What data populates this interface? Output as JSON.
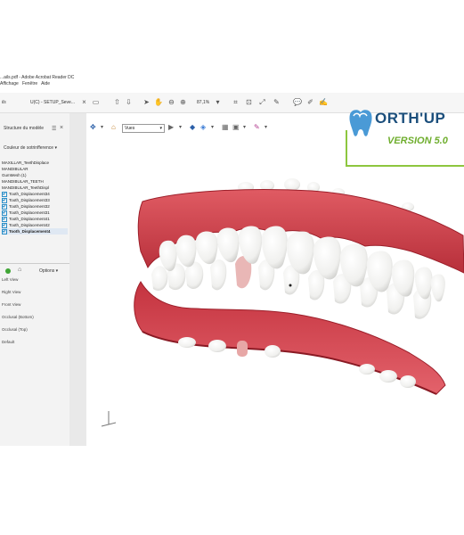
{
  "window": {
    "title": "...ails.pdf - Adobe Acrobat Reader DC",
    "menu": [
      "Affichage",
      "Fenêtre",
      "Aide"
    ]
  },
  "toolbar": {
    "home_label": "ils",
    "file_tab": "U(C) - SETUP_Seve...",
    "zoom": "87,1%"
  },
  "sidebar": {
    "title": "Structure du modèle",
    "color_mode": "Couleur de sotrinfference",
    "tree": [
      {
        "label": "MAXILLAR_TeethDisplace",
        "checked": false,
        "selected": false
      },
      {
        "label": "MANDIBULAR",
        "checked": false,
        "selected": false
      },
      {
        "label": "GumMesh (1)",
        "checked": false,
        "selected": false
      },
      {
        "label": "MANDIBULAR_TEETH",
        "checked": false,
        "selected": false
      },
      {
        "label": "MANDIBULAR_TeethDispl",
        "checked": false,
        "selected": false
      },
      {
        "label": "Tooth_Displacement34",
        "checked": true,
        "selected": false
      },
      {
        "label": "Tooth_Displacement33",
        "checked": true,
        "selected": false
      },
      {
        "label": "Tooth_Displacement32",
        "checked": true,
        "selected": false
      },
      {
        "label": "Tooth_Displacement31",
        "checked": true,
        "selected": false
      },
      {
        "label": "Tooth_Displacement41",
        "checked": true,
        "selected": false
      },
      {
        "label": "Tooth_Displacement42",
        "checked": true,
        "selected": false
      },
      {
        "label": "Tooth_Displacement4",
        "checked": true,
        "selected": true
      }
    ],
    "options_label": "Options",
    "views": [
      "Left View",
      "Right View",
      "Front View",
      "Occlusal (Bottom)",
      "Occlusal (Top)",
      "Default"
    ]
  },
  "view_toolbar": {
    "view_select": "Vues"
  },
  "brand": {
    "name": "ORTH'UP",
    "version": "VERSION 5.0",
    "accent": "#8dc63f",
    "text_color": "#1c4f7c"
  },
  "colors": {
    "gum": "#d9434d",
    "gum_dark": "#9c1f2a",
    "teeth": "#f4f4f2"
  }
}
